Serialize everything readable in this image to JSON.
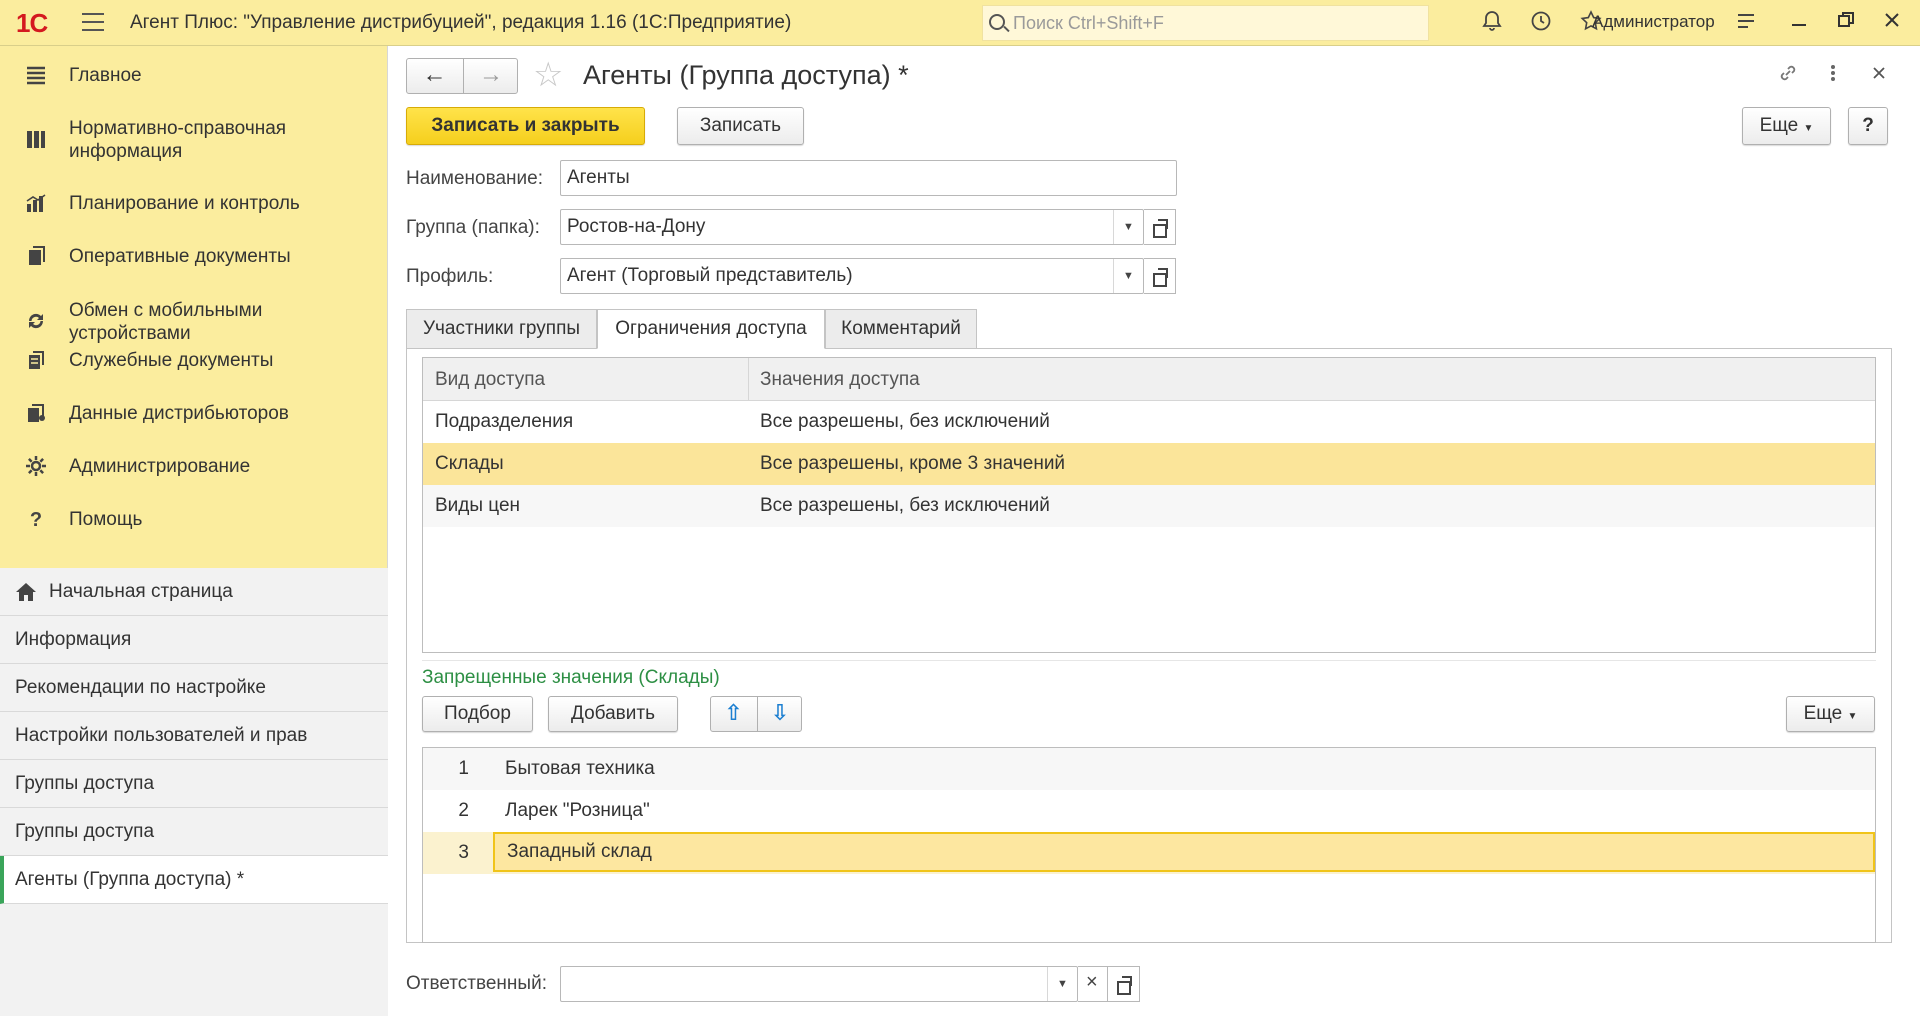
{
  "window": {
    "logo": "1С",
    "title": "Агент Плюс: \"Управление дистрибуцией\", редакция 1.16  (1С:Предприятие)",
    "search_placeholder": "Поиск Ctrl+Shift+F",
    "user": "Администратор"
  },
  "sidebar": {
    "sections": [
      {
        "label": "Главное",
        "icon": "list-icon"
      },
      {
        "label": "Нормативно-справочная\nинформация",
        "icon": "catalog-icon"
      },
      {
        "label": "Планирование и контроль",
        "icon": "bar-chart-icon"
      },
      {
        "label": "Оперативные документы",
        "icon": "documents-icon"
      },
      {
        "label": "Обмен с мобильными\nустройствами",
        "icon": "sync-icon"
      },
      {
        "label": "Служебные документы",
        "icon": "service-docs-icon"
      },
      {
        "label": "Данные дистрибьюторов",
        "icon": "distributor-data-icon"
      },
      {
        "label": "Администрирование",
        "icon": "gear-icon"
      },
      {
        "label": "Помощь",
        "icon": "help-icon"
      }
    ],
    "open_windows": [
      {
        "label": "Начальная страница",
        "home": true
      },
      {
        "label": "Информация"
      },
      {
        "label": "Рекомендации по настройке"
      },
      {
        "label": "Настройки пользователей и прав"
      },
      {
        "label": "Группы доступа"
      },
      {
        "label": "Группы доступа"
      },
      {
        "label": "Агенты (Группа доступа) *",
        "active": true
      }
    ]
  },
  "form": {
    "title": "Агенты (Группа доступа) *",
    "save_close_label": "Записать и закрыть",
    "save_label": "Записать",
    "more_label": "Еще",
    "help_label": "?",
    "name_label": "Наименование:",
    "name_value": "Агенты",
    "group_label": "Группа (папка):",
    "group_value": "Ростов-на-Дону",
    "profile_label": "Профиль:",
    "profile_value": "Агент (Торговый представитель)",
    "tabs": [
      "Участники группы",
      "Ограничения доступа",
      "Комментарий"
    ],
    "active_tab": 1,
    "access_table": {
      "columns": [
        "Вид доступа",
        "Значения доступа"
      ],
      "rows": [
        {
          "kind": "Подразделения",
          "values": "Все разрешены, без исключений"
        },
        {
          "kind": "Склады",
          "values": "Все разрешены, кроме 3 значений",
          "selected": true
        },
        {
          "kind": "Виды цен",
          "values": "Все разрешены, без исключений"
        }
      ]
    },
    "denied_title": "Запрещенные значения (Склады)",
    "pick_label": "Подбор",
    "add_label": "Добавить",
    "more2_label": "Еще",
    "denied_table": {
      "rows": [
        {
          "n": "1",
          "value": "Бытовая техника"
        },
        {
          "n": "2",
          "value": "Ларек \"Розница\""
        },
        {
          "n": "3",
          "value": "Западный склад",
          "selected": true
        }
      ]
    },
    "responsible_label": "Ответственный:",
    "responsible_value": ""
  },
  "colors": {
    "accent_yellow": "#fbed9e",
    "primary_button": "#f5cf1d",
    "selected_row": "#fbe59a",
    "green_title": "#2d8f44",
    "logo_red": "#d4191f"
  }
}
